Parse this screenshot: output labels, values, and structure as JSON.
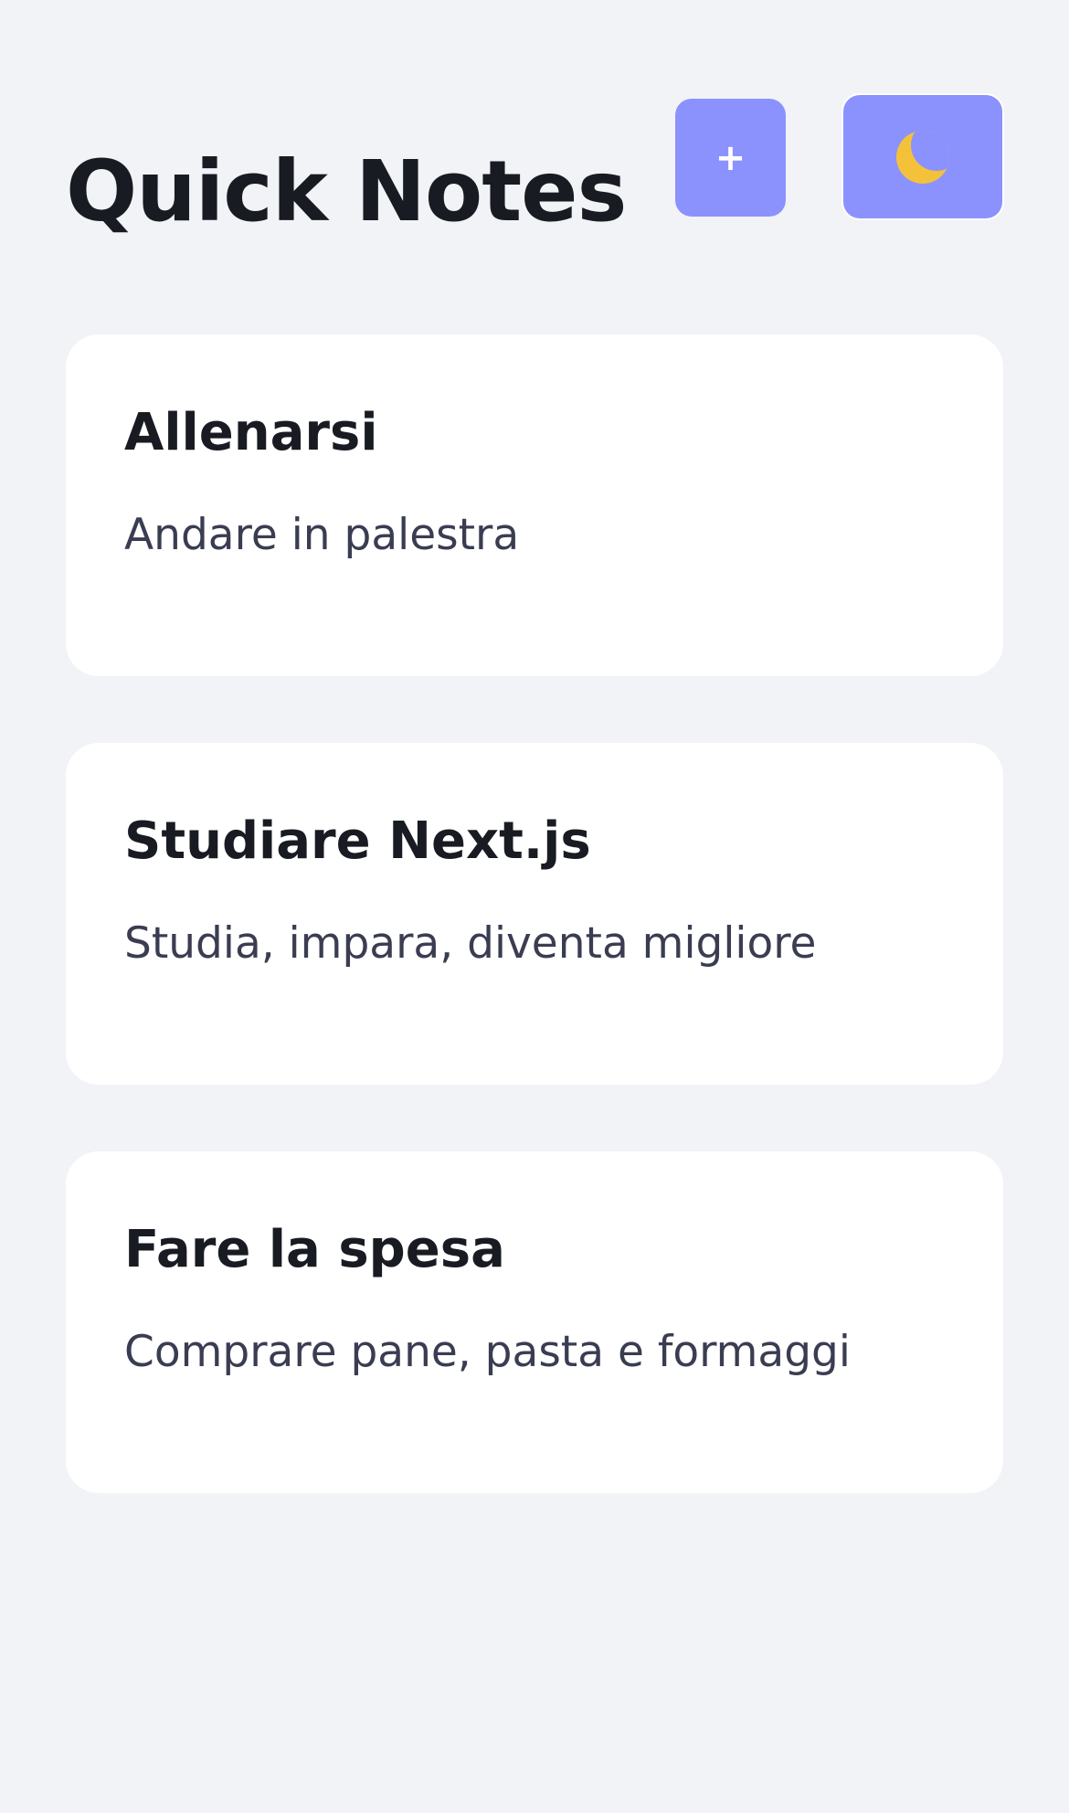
{
  "app": {
    "title": "Quick Notes"
  },
  "toolbar": {
    "add_label": "+",
    "theme_icon": "moon-icon",
    "accent_color": "#8b92fe",
    "moon_color": "#f4c23a"
  },
  "notes": [
    {
      "title": "Allenarsi",
      "body": "Andare in palestra"
    },
    {
      "title": "Studiare Next.js",
      "body": "Studia, impara, diventa migliore"
    },
    {
      "title": "Fare la spesa",
      "body": "Comprare pane, pasta e formaggi"
    }
  ]
}
